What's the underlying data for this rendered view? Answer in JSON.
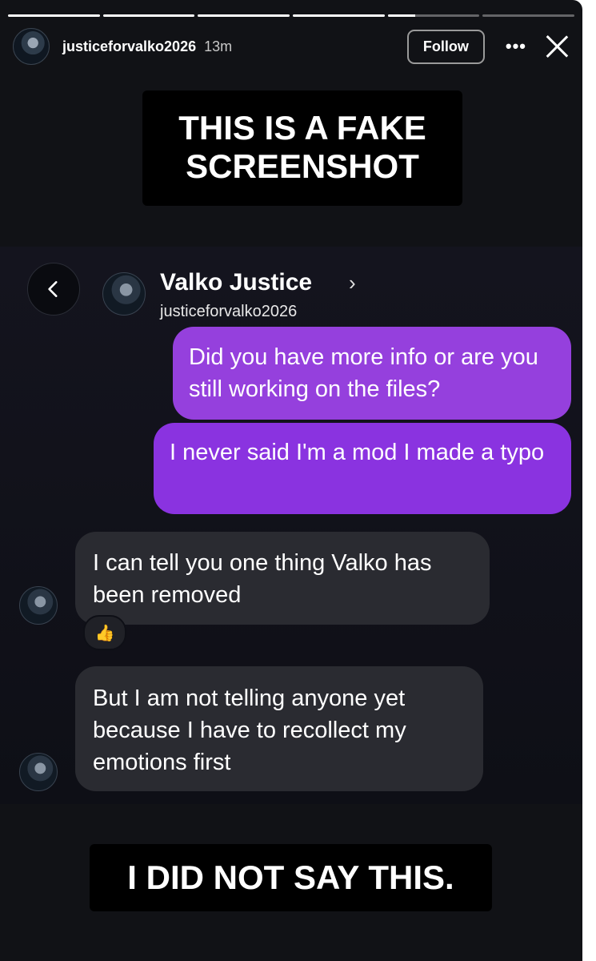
{
  "story": {
    "username": "justiceforvalko2026",
    "time": "13m",
    "follow_label": "Follow",
    "more_icon": "•••",
    "progress": [
      1,
      1,
      1,
      1,
      0.3,
      0
    ]
  },
  "captions": {
    "top": "THIS IS A FAKE\nSCREENSHOT",
    "bottom": "I DID NOT SAY THIS."
  },
  "chat": {
    "contact_name": "Valko Justice",
    "chevron": "›",
    "contact_handle": "justiceforvalko2026",
    "messages": [
      {
        "from": "me",
        "text": "Did you have more info or are you still working on the files?"
      },
      {
        "from": "me",
        "text": "I never said I'm a mod I made a typo"
      },
      {
        "from": "them",
        "text": "I can tell you one thing Valko has been removed",
        "reaction": "👍"
      },
      {
        "from": "them",
        "text": "But I am not telling anyone yet because I have to recollect my emotions first"
      }
    ]
  },
  "colors": {
    "background": "#111216",
    "outgoing_bubble": "#8a33e0",
    "incoming_bubble": "#2a2b31"
  }
}
